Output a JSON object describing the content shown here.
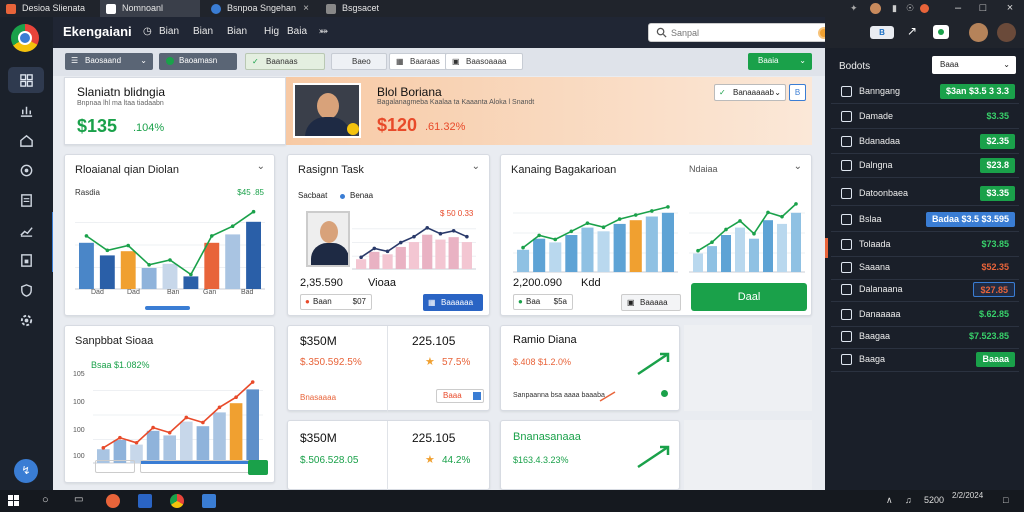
{
  "browser": {
    "tabs": [
      {
        "label": "Desioa Slienata",
        "active": false
      },
      {
        "label": "Nomnoanl",
        "active": true
      },
      {
        "label": "Bsnpoa Sngehan",
        "active": false
      },
      {
        "label": "Bsgsacet",
        "active": false
      }
    ],
    "tab_close": "×",
    "window_controls": [
      "–",
      "□",
      "×"
    ]
  },
  "app": {
    "title": "Ekengaiani",
    "menu": [
      "Bian",
      "Bian",
      "Bian",
      "Hig",
      "Baia",
      "⤘"
    ],
    "search": {
      "placeholder": "Sanpal",
      "value": ""
    }
  },
  "topright": {
    "tag": "B",
    "icons": [
      "dock-icon",
      "chat-icon",
      "avatar",
      "avatar"
    ]
  },
  "toolbar": {
    "dropdown_label": "Baosaand",
    "filter_label": "Baoamasn",
    "btn3_label": "Baanaas",
    "btn4_label": "Baeo",
    "btn5_label": "Baaraas",
    "btn6_label": "Baasoaaaa",
    "action_label": "Baaia"
  },
  "banner": {
    "left_title": "Slaniatn blidngia",
    "left_sub": "Bnpnaa lhl ma ltaa tiadaabn",
    "left_value": "$135",
    "left_pct": ".104%",
    "right_title": "Blol Boriana",
    "right_sub": "Bagalanagmeba Kaalaa ta Kaaanta Aloka l Snandt",
    "right_value": "$120",
    "right_pct": ".61.32%",
    "select_label": "Banaaaaab",
    "select_btn": "B"
  },
  "card1": {
    "title": "Rloaianal qian Diolan",
    "legend_left": "Rasdia",
    "legend_right": "$45 .85",
    "x_labels": [
      "Dad",
      "Dad",
      "Ban",
      "Gan",
      "Bad"
    ]
  },
  "card2": {
    "title": "Rasignn Task",
    "legend": [
      "Sacbaat",
      "Benaa"
    ],
    "legend_right": "$ 50 0.33",
    "value": "2,35.590",
    "value_label": "Vioaa",
    "chip1": "Baan",
    "chip1_value": "$07",
    "chip2": "Baaaaaa"
  },
  "card3": {
    "title": "Kanaing Bagakarioan",
    "title_right": "Ndaiaa",
    "value": "2,200.090",
    "value_label": "Kdd",
    "chip1": "Baa",
    "chip1_value": "$5a",
    "chip2": "Baaaaa",
    "cta": "Daal"
  },
  "card4": {
    "title": "Sanpbbat Sioaa",
    "sub": "Bsaa $1.082%",
    "y_labels": [
      "105",
      "100",
      "100",
      "100"
    ]
  },
  "stat1": {
    "value_a": "$350M",
    "value_b": "225.105",
    "pct_a": "$.350.592.5%",
    "pct_b": "57.5%",
    "footer": "Bnasaaaa",
    "chip": "Baaa"
  },
  "stat2": {
    "title": "Ramio Diana",
    "sub": "$.408 $1.2.0%",
    "footer": "Sanpaanna bsa aaaa baaaba"
  },
  "stat3": {
    "value_a": "$350M",
    "value_b": "225.105",
    "pct_a": "$.506.528.05",
    "pct_b": "44.2%"
  },
  "stat4": {
    "title": "Bnanasanaaa",
    "sub": "$163.4.3.23%"
  },
  "sidebar": {
    "header": "Bodots",
    "header_select": "Baaa",
    "rows": [
      {
        "label": "Banngang",
        "value": "$3an $3.5 3 3.3",
        "color": "#1aa14a",
        "style": "fill"
      },
      {
        "label": "Damade",
        "value": "$3.35",
        "color": "#38d06a",
        "style": "text"
      },
      {
        "label": "Bdanadaa",
        "value": "$2.35",
        "color": "#1aa14a",
        "style": "fill"
      },
      {
        "label": "Dalngna",
        "value": "$23.8",
        "color": "#1aa14a",
        "style": "fill"
      },
      {
        "label": "Datoonbaea",
        "value": "$3.35",
        "color": "#1aa14a",
        "style": "fill"
      },
      {
        "label": "Bslaa",
        "value": "Badaa $3.5 $3.595",
        "color": "#3a7dd4",
        "style": "fill"
      },
      {
        "label": "Tolaada",
        "value": "$73.85",
        "color": "#38d06a",
        "style": "text"
      },
      {
        "label": "Saaana",
        "value": "$52.35",
        "color": "#e8643a",
        "style": "text"
      },
      {
        "label": "Dalanaana",
        "value": "$27.85",
        "color": "#e8643a",
        "style": "outline"
      },
      {
        "label": "Danaaaaa",
        "value": "$.62.85",
        "color": "#38d06a",
        "style": "text"
      },
      {
        "label": "Baagaa",
        "value": "$7.523.85",
        "color": "#38d06a",
        "style": "text"
      },
      {
        "label": "Baaga",
        "value": "Baaaa",
        "color": "#1aa14a",
        "style": "fill"
      }
    ]
  },
  "taskbar": {
    "clock": "5200",
    "date": "2/2/2024"
  },
  "chart_data": [
    {
      "type": "bar",
      "title": "Rloaianal qian Diolan",
      "categories": [
        "Dad",
        "Dad",
        "Ban",
        "Gan",
        "Bad"
      ],
      "series": [
        {
          "values": [
            55,
            40,
            45,
            25,
            30,
            15,
            55,
            65,
            80
          ]
        }
      ],
      "ylim": [
        0,
        100
      ]
    },
    {
      "type": "bar",
      "title": "Rasignn Task",
      "series": [
        {
          "values": [
            20,
            35,
            30,
            45,
            55,
            70,
            60,
            65,
            55
          ]
        }
      ],
      "ylim": [
        0,
        100
      ]
    },
    {
      "type": "bar",
      "title": "Kanaing Bagakarioan",
      "series": [
        {
          "values": [
            30,
            45,
            40,
            50,
            60,
            55,
            65,
            70,
            75,
            80
          ]
        }
      ],
      "ylim": [
        0,
        100
      ]
    },
    {
      "type": "bar",
      "title": "Sanpbbat Sioaa",
      "series": [
        {
          "values": [
            15,
            25,
            20,
            35,
            30,
            45,
            40,
            55,
            65,
            80
          ]
        }
      ],
      "ylim": [
        0,
        100
      ]
    }
  ]
}
